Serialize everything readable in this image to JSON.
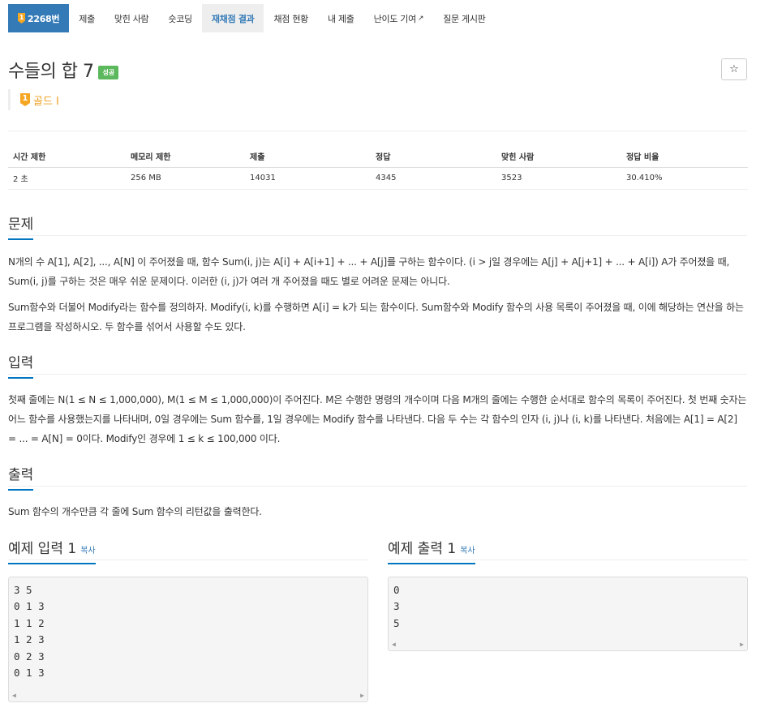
{
  "tabs": [
    {
      "label": "2268번"
    },
    {
      "label": "제출"
    },
    {
      "label": "맞힌 사람"
    },
    {
      "label": "숏코딩"
    },
    {
      "label": "재채점 결과"
    },
    {
      "label": "채점 현황"
    },
    {
      "label": "내 제출"
    },
    {
      "label": "난이도 기여"
    },
    {
      "label": "질문 게시판"
    }
  ],
  "problem": {
    "title": "수들의 합 7",
    "status_label": "성공",
    "star": "☆",
    "tier_badge": "1",
    "tier": "골드 I"
  },
  "info_table": {
    "headers": [
      "시간 제한",
      "메모리 제한",
      "제출",
      "정답",
      "맞힌 사람",
      "정답 비율"
    ],
    "values": [
      "2 초",
      "256 MB",
      "14031",
      "4345",
      "3523",
      "30.410%"
    ]
  },
  "sections": {
    "description_title": "문제",
    "description_p1": "N개의 수 A[1], A[2], ..., A[N] 이 주어졌을 때, 함수 Sum(i, j)는 A[i] + A[i+1] + ... + A[j]를 구하는 함수이다. (i > j일 경우에는 A[j] + A[j+1] + ... + A[i]) A가 주어졌을 때, Sum(i, j)를 구하는 것은 매우 쉬운 문제이다. 이러한 (i, j)가 여러 개 주어졌을 때도 별로 어려운 문제는 아니다.",
    "description_p2": "Sum함수와 더불어 Modify라는 함수를 정의하자. Modify(i, k)를 수행하면 A[i] = k가 되는 함수이다. Sum함수와 Modify 함수의 사용 목록이 주어졌을 때, 이에 해당하는 연산을 하는 프로그램을 작성하시오. 두 함수를 섞어서 사용할 수도 있다.",
    "input_title": "입력",
    "input_p": "첫째 줄에는 N(1 ≤ N ≤ 1,000,000), M(1 ≤ M ≤ 1,000,000)이 주어진다. M은 수행한 명령의 개수이며 다음 M개의 줄에는 수행한 순서대로 함수의 목록이 주어진다. 첫 번째 숫자는 어느 함수를 사용했는지를 나타내며, 0일 경우에는 Sum 함수를, 1일 경우에는 Modify 함수를 나타낸다. 다음 두 수는 각 함수의 인자 (i, j)나 (i, k)를 나타낸다. 처음에는 A[1] = A[2] = ... = A[N] = 0이다. Modify인 경우에 1 ≤ k ≤ 100,000 이다.",
    "output_title": "출력",
    "output_p": "Sum 함수의 개수만큼 각 줄에 Sum 함수의 리턴값을 출력한다."
  },
  "samples": {
    "input_title": "예제 입력 1",
    "output_title": "예제 출력 1",
    "copy_label": "복사",
    "input_text": "3 5\n0 1 3\n1 1 2\n1 2 3\n0 2 3\n0 1 3",
    "output_text": "0\n3\n5"
  }
}
